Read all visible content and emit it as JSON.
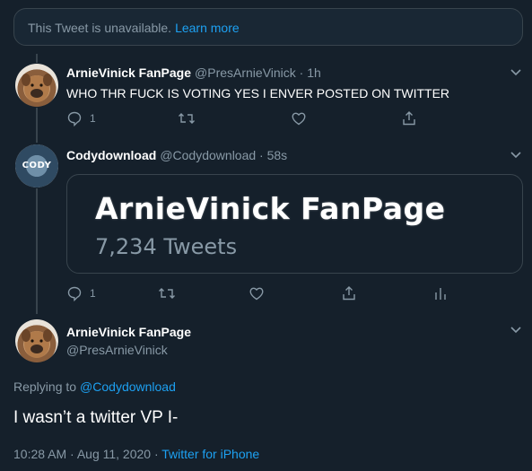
{
  "notice": {
    "text": "This Tweet is unavailable.",
    "link": "Learn more"
  },
  "tweets": [
    {
      "name": "ArnieVinick FanPage",
      "meta": "@PresArnieVinick · 1h",
      "text": "WHO THR FUCK IS VOTING YES I ENVER POSTED ON TWITTER",
      "reply_count": "1",
      "avatar_icon": "dog-avatar"
    },
    {
      "name": "Codydownload",
      "meta": "@Codydownload · 58s",
      "avatar_text": "CODY",
      "avatar_icon": "cody-avatar",
      "embed": {
        "title": "ArnieVinick FanPage",
        "subtitle": "7,234 Tweets"
      },
      "reply_count": "1"
    }
  ],
  "main_tweet": {
    "name": "ArnieVinick FanPage",
    "handle": "@PresArnieVinick",
    "replying_prefix": "Replying to",
    "replying_to": "@Codydownload",
    "text": "I wasn’t a twitter VP I-",
    "timestamp": "10:28 AM · Aug 11, 2020 · ",
    "client": "Twitter for iPhone",
    "avatar_icon": "dog-avatar"
  },
  "colors": {
    "background": "#15202b",
    "border": "#38444d",
    "muted": "#8899a6",
    "accent": "#1da1f2"
  }
}
